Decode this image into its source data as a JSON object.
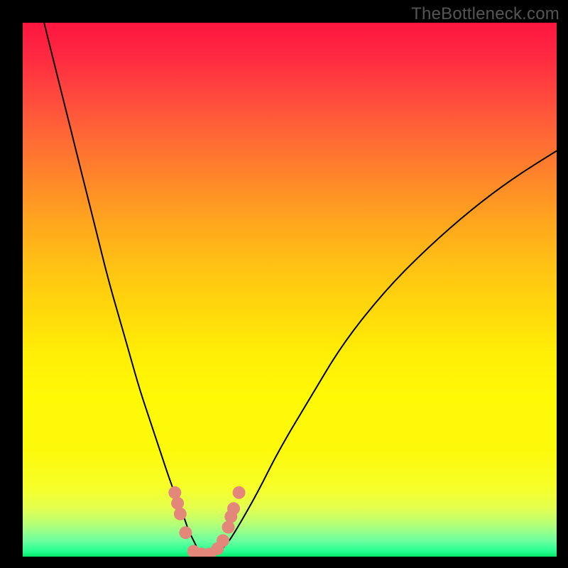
{
  "watermark": "TheBottleneck.com",
  "colors": {
    "gradient_top": "#ff163f",
    "gradient_mid": "#ffee06",
    "gradient_bottom": "#07e76a",
    "curve": "#000000",
    "markers": "#e3877a",
    "frame": "#000000"
  },
  "chart_data": {
    "type": "line",
    "title": "",
    "xlabel": "",
    "ylabel": "",
    "xlim": [
      0,
      100
    ],
    "ylim": [
      0,
      100
    ],
    "series": [
      {
        "name": "bottleneck-curve",
        "x": [
          4,
          6,
          8,
          10,
          12,
          14,
          16,
          18,
          20,
          22,
          24,
          26,
          28,
          30,
          31,
          32,
          33,
          34,
          35,
          36,
          38,
          40,
          44,
          48,
          54,
          60,
          68,
          76,
          84,
          92,
          100
        ],
        "y": [
          100,
          92,
          84,
          76,
          68,
          60,
          52,
          45,
          38,
          31,
          25,
          19,
          13,
          8,
          5,
          3,
          1,
          0,
          0,
          0.5,
          2,
          5,
          12,
          20,
          30,
          40,
          50,
          58,
          65,
          71,
          76
        ]
      }
    ],
    "markers": {
      "name": "highlighted-points",
      "points": [
        {
          "x": 28.5,
          "y": 12
        },
        {
          "x": 29.0,
          "y": 10
        },
        {
          "x": 29.5,
          "y": 8
        },
        {
          "x": 30.5,
          "y": 4.5
        },
        {
          "x": 32.0,
          "y": 1.0
        },
        {
          "x": 33.5,
          "y": 0.5
        },
        {
          "x": 35.0,
          "y": 0.5
        },
        {
          "x": 36.5,
          "y": 1.5
        },
        {
          "x": 37.5,
          "y": 3.0
        },
        {
          "x": 38.5,
          "y": 5.5
        },
        {
          "x": 39.0,
          "y": 7.5
        },
        {
          "x": 39.5,
          "y": 9.0
        },
        {
          "x": 40.5,
          "y": 12.0
        }
      ]
    }
  }
}
